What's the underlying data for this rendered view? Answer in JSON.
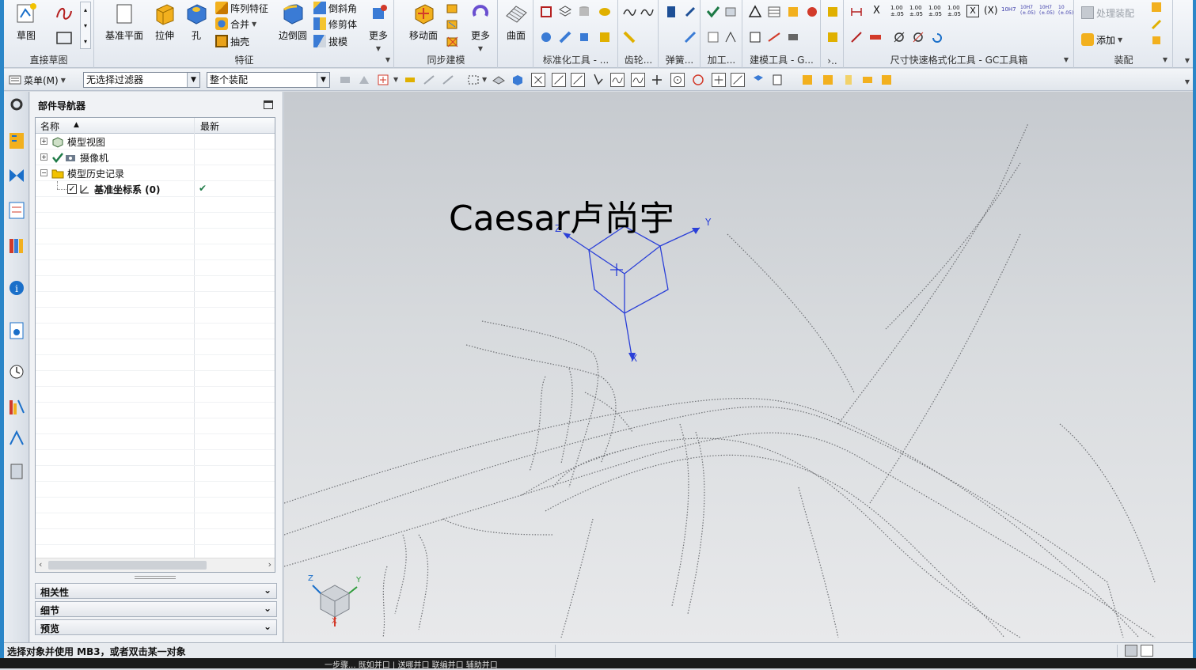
{
  "ribbon": {
    "groups": {
      "direct_sketch": "直接草图",
      "feature": "特征",
      "sync_modeling": "同步建模",
      "standard_tools": "标准化工具 - ...",
      "gear": "齿轮...",
      "spring": "弹簧...",
      "machining": "加工...",
      "modeling_tools": "建模工具 - G...",
      "more_g": "›..",
      "dimension_tools": "尺寸快速格式化工具 - GC工具箱",
      "assembly": "装配"
    },
    "buttons": {
      "sketch": "草图",
      "datum_plane": "基准平面",
      "extrude": "拉伸",
      "hole": "孔",
      "pattern_feature": "阵列特征",
      "unite": "合并",
      "shell": "抽壳",
      "edge_blend": "边倒圆",
      "chamfer": "倒斜角",
      "trim_body": "修剪体",
      "draft": "拔模",
      "more_feature": "更多",
      "move_face": "移动面",
      "more_sync": "更多",
      "surface": "曲面",
      "process_assembly": "处理装配",
      "add": "添加"
    },
    "dim_labels": [
      "1.00 ±.05",
      "1.00 ±.05",
      "1.00 ±.05",
      "1.00 ±.05",
      "X",
      "(X)",
      "10H7",
      "10H7 (±.05)",
      "10H7 (±.05)",
      "10 (±.05)"
    ]
  },
  "toolbar2": {
    "menu_label": "菜单(M)",
    "filter_value": "无选择过滤器",
    "assembly_scope": "整个装配"
  },
  "navigator": {
    "title": "部件导航器",
    "columns": [
      "名称",
      "最新"
    ],
    "rows": [
      {
        "label": "模型视图",
        "expand": "+",
        "latest": ""
      },
      {
        "label": "摄像机",
        "expand": "+",
        "latest": ""
      },
      {
        "label": "模型历史记录",
        "expand": "−",
        "latest": ""
      },
      {
        "label": "基准坐标系 (0)",
        "expand": "",
        "latest": "✔"
      }
    ],
    "panels": [
      "相关性",
      "细节",
      "预览"
    ]
  },
  "graphics": {
    "watermark": "Caesar卢尚宇",
    "csys_axes": {
      "x": "X",
      "y": "Y",
      "z": "Z"
    },
    "triad_axes": {
      "x": "X",
      "y": "Y",
      "z": "Z"
    }
  },
  "statusbar": {
    "message": "选择对象并使用 MB3，或者双击某一对象"
  },
  "taskbar": {
    "fragment": "一步骤...       既如并口 | 送哪并口   联编并口  辅助并口"
  },
  "colors": {
    "accent_blue": "#2b86c8",
    "csys_blue": "#2a3fd8",
    "triad_red": "#d23a2a"
  }
}
